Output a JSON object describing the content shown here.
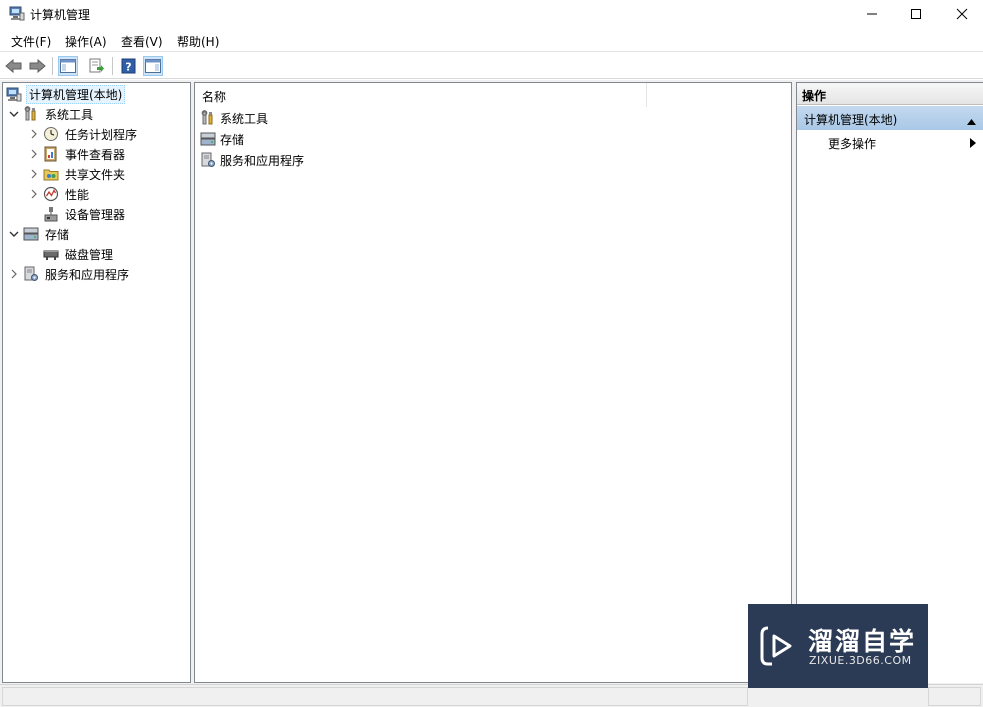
{
  "window": {
    "title": "计算机管理",
    "icon": "computer-management-icon"
  },
  "menu": [
    {
      "label": "文件(F)"
    },
    {
      "label": "操作(A)"
    },
    {
      "label": "查看(V)"
    },
    {
      "label": "帮助(H)"
    }
  ],
  "toolbar": {
    "buttons": [
      "back-arrow-icon",
      "forward-arrow-icon",
      "show-hide-tree-icon",
      "export-list-icon",
      "help-icon",
      "show-hide-action-pane-icon"
    ]
  },
  "tree": {
    "root": {
      "label": "计算机管理(本地)",
      "icon": "computer-management-icon"
    },
    "items": [
      {
        "label": "系统工具",
        "icon": "tools-icon",
        "expanded": true
      },
      {
        "label": "任务计划程序",
        "icon": "clock-icon",
        "expanded": false
      },
      {
        "label": "事件查看器",
        "icon": "event-viewer-icon",
        "expanded": false
      },
      {
        "label": "共享文件夹",
        "icon": "shared-folder-icon",
        "expanded": false
      },
      {
        "label": "性能",
        "icon": "performance-icon",
        "expanded": false
      },
      {
        "label": "设备管理器",
        "icon": "device-manager-icon"
      },
      {
        "label": "存储",
        "icon": "storage-icon",
        "expanded": true
      },
      {
        "label": "磁盘管理",
        "icon": "disk-icon"
      },
      {
        "label": "服务和应用程序",
        "icon": "services-icon",
        "expanded": false
      }
    ]
  },
  "list": {
    "column_header": "名称",
    "rows": [
      {
        "label": "系统工具",
        "icon": "tools-icon"
      },
      {
        "label": "存储",
        "icon": "storage-icon"
      },
      {
        "label": "服务和应用程序",
        "icon": "services-icon"
      }
    ]
  },
  "actions": {
    "header": "操作",
    "section_title": "计算机管理(本地)",
    "items": [
      {
        "label": "更多操作"
      }
    ]
  },
  "watermark": {
    "title": "溜溜自学",
    "subtitle": "ZIXUE.3D66.COM"
  },
  "colors": {
    "selection_blue": "#cde4f7",
    "action_section_bg": "#b7d1ec",
    "watermark_bg": "#2b3a55"
  }
}
